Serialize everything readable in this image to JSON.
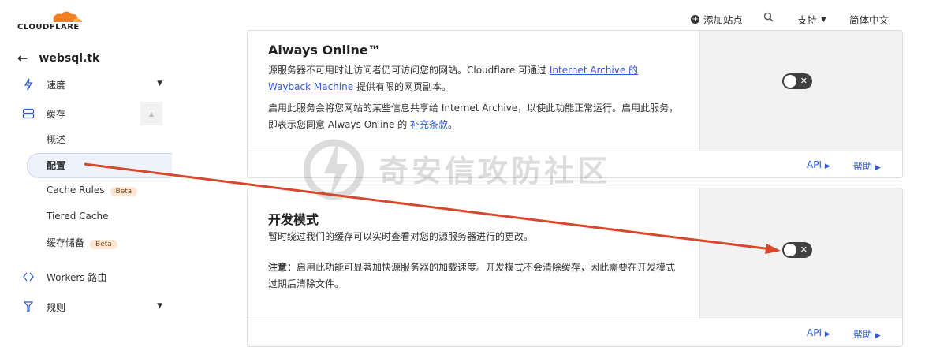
{
  "header": {
    "logo_text": "CLOUDFLARE",
    "add_site": "添加站点",
    "support": "支持",
    "language": "简体中文"
  },
  "sidebar": {
    "site": "websql.tk",
    "items": [
      {
        "label": "速度"
      },
      {
        "label": "缓存"
      },
      {
        "label": "概述"
      },
      {
        "label": "配置"
      },
      {
        "label": "Cache Rules",
        "badge": "Beta"
      },
      {
        "label": "Tiered Cache"
      },
      {
        "label": "缓存储备",
        "badge": "Beta"
      },
      {
        "label": "Workers 路由"
      },
      {
        "label": "规则"
      }
    ]
  },
  "always_online": {
    "title": "Always Online™",
    "desc_pre": "源服务器不可用时让访问者仍可访问您的网站。Cloudflare 可通过 ",
    "desc_link": "Internet Archive 的 Wayback Machine",
    "desc_post": " 提供有限的网页副本。",
    "note_pre": "启用此服务会将您网站的某些信息共享给 Internet Archive，以使此功能正常运行。启用此服务，即表示您同意 Always Online 的 ",
    "note_link": "补充条款",
    "note_post": "。",
    "toggle_on": false,
    "api_label": "API",
    "help_label": "帮助"
  },
  "dev_mode": {
    "title": "开发模式",
    "desc": "暂时绕过我们的缓存可以实时查看对您的源服务器进行的更改。",
    "note_label": "注意：",
    "note": "启用此功能可显著加快源服务器的加载速度。开发模式不会清除缓存，因此需要在开发模式过期后清除文件。",
    "toggle_on": false,
    "api_label": "API",
    "help_label": "帮助"
  },
  "watermark": {
    "text": "奇安信攻防社区"
  },
  "colors": {
    "accent": "#2f5bd6",
    "toggle_off": "#404040",
    "arrow": "#d9472b",
    "logo_orange": "#f38020"
  }
}
